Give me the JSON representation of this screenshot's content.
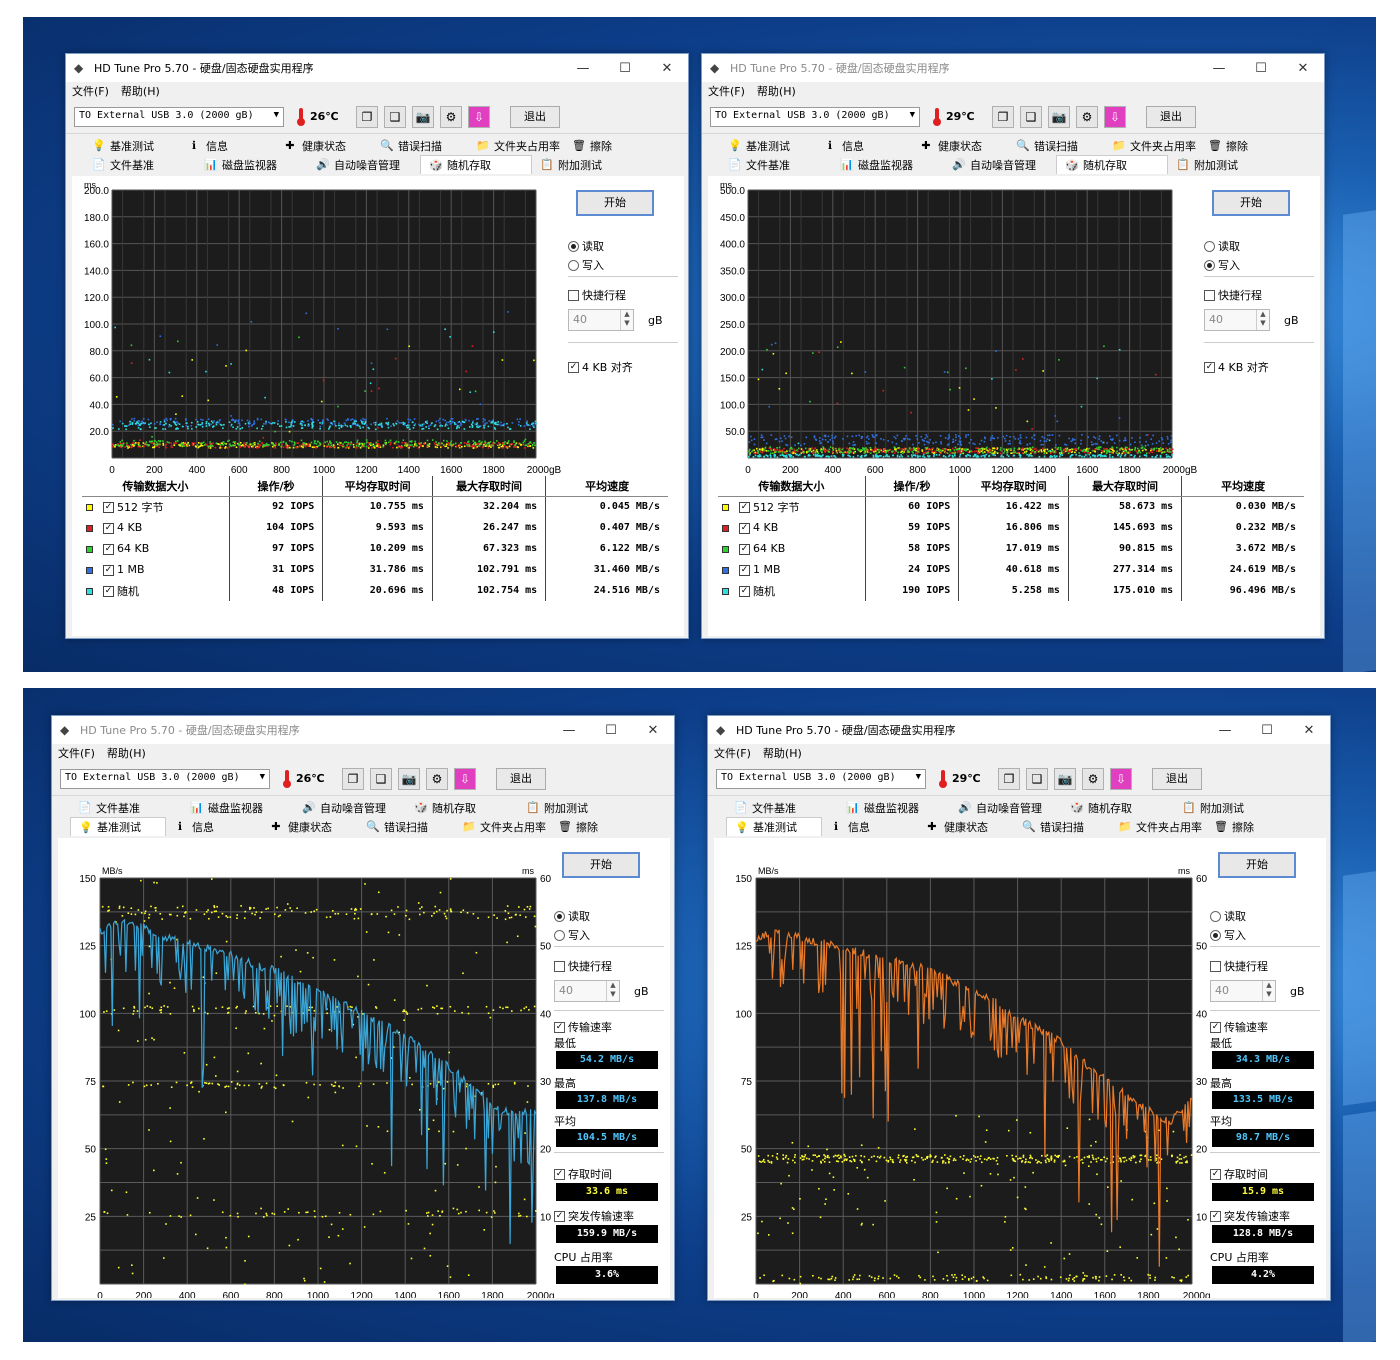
{
  "colors": {
    "blue": "#3aa6d8",
    "orange": "#e87a2a",
    "yellow": "#ffff30",
    "grid": "#5a5a5a"
  },
  "windows": [
    {
      "id": "w1",
      "title": "HD Tune Pro 5.70 - 硬盘/固态硬盘实用程序",
      "menus": [
        "文件(F)",
        "帮助(H)"
      ],
      "drive": "TO External USB 3.0 (2000 gB)",
      "temp": "26℃",
      "exit": "退出",
      "tabs_top": [
        "基准测试",
        "信息",
        "健康状态",
        "错误扫描",
        "文件夹占用率",
        "擦除"
      ],
      "tabs_bottom": [
        "文件基准",
        "磁盘监视器",
        "自动噪音管理",
        "随机存取",
        "附加测试"
      ],
      "start": "开始",
      "read": "读取",
      "write": "写入",
      "quick": "快捷行程",
      "quick_val": "40",
      "gb": "gB",
      "align": "4 KB 对齐",
      "y_unit": "ms",
      "y_ticks": [
        "200.0",
        "180.0",
        "160.0",
        "140.0",
        "120.0",
        "100.0",
        "80.0",
        "60.0",
        "40.0",
        "20.0"
      ],
      "x_ticks": [
        "0",
        "200",
        "400",
        "600",
        "800",
        "1000",
        "1200",
        "1400",
        "1600",
        "1800",
        "2000gB"
      ],
      "headers": [
        "传输数据大小",
        "操作/秒",
        "平均存取时间",
        "最大存取时间",
        "平均速度"
      ],
      "rows": [
        {
          "size": "512 字节",
          "iops": "92 IOPS",
          "avg": "10.755 ms",
          "max": "32.204 ms",
          "speed": "0.045 MB/s",
          "color": "#ffff00"
        },
        {
          "size": "4 KB",
          "iops": "104 IOPS",
          "avg": "9.593 ms",
          "max": "26.247 ms",
          "speed": "0.407 MB/s",
          "color": "#e02020"
        },
        {
          "size": "64 KB",
          "iops": "97 IOPS",
          "avg": "10.209 ms",
          "max": "67.323 ms",
          "speed": "6.122 MB/s",
          "color": "#30d030"
        },
        {
          "size": "1 MB",
          "iops": "31 IOPS",
          "avg": "31.786 ms",
          "max": "102.791 ms",
          "speed": "31.460 MB/s",
          "color": "#3070e0"
        },
        {
          "size": "随机",
          "iops": "48 IOPS",
          "avg": "20.696 ms",
          "max": "102.754 ms",
          "speed": "24.516 MB/s",
          "color": "#30e0e0"
        }
      ]
    },
    {
      "id": "w2",
      "title": "HD Tune Pro 5.70 - 硬盘/固态硬盘实用程序",
      "menus": [
        "文件(F)",
        "帮助(H)"
      ],
      "drive": "TO External USB 3.0 (2000 gB)",
      "temp": "29℃",
      "exit": "退出",
      "tabs_top": [
        "基准测试",
        "信息",
        "健康状态",
        "错误扫描",
        "文件夹占用率",
        "擦除"
      ],
      "tabs_bottom": [
        "文件基准",
        "磁盘监视器",
        "自动噪音管理",
        "随机存取",
        "附加测试"
      ],
      "start": "开始",
      "read": "读取",
      "write": "写入",
      "quick": "快捷行程",
      "quick_val": "40",
      "gb": "gB",
      "align": "4 KB 对齐",
      "y_unit": "ms",
      "y_ticks": [
        "500.0",
        "450.0",
        "400.0",
        "350.0",
        "300.0",
        "250.0",
        "200.0",
        "150.0",
        "100.0",
        "50.0"
      ],
      "x_ticks": [
        "0",
        "200",
        "400",
        "600",
        "800",
        "1000",
        "1200",
        "1400",
        "1600",
        "1800",
        "2000gB"
      ],
      "headers": [
        "传输数据大小",
        "操作/秒",
        "平均存取时间",
        "最大存取时间",
        "平均速度"
      ],
      "rows": [
        {
          "size": "512 字节",
          "iops": "60 IOPS",
          "avg": "16.422 ms",
          "max": "58.673 ms",
          "speed": "0.030 MB/s",
          "color": "#ffff00"
        },
        {
          "size": "4 KB",
          "iops": "59 IOPS",
          "avg": "16.806 ms",
          "max": "145.693 ms",
          "speed": "0.232 MB/s",
          "color": "#e02020"
        },
        {
          "size": "64 KB",
          "iops": "58 IOPS",
          "avg": "17.019 ms",
          "max": "90.815 ms",
          "speed": "3.672 MB/s",
          "color": "#30d030"
        },
        {
          "size": "1 MB",
          "iops": "24 IOPS",
          "avg": "40.618 ms",
          "max": "277.314 ms",
          "speed": "24.619 MB/s",
          "color": "#3070e0"
        },
        {
          "size": "随机",
          "iops": "190 IOPS",
          "avg": "5.258 ms",
          "max": "175.010 ms",
          "speed": "96.496 MB/s",
          "color": "#30e0e0"
        }
      ]
    },
    {
      "id": "w3",
      "title": "HD Tune Pro 5.70 - 硬盘/固态硬盘实用程序",
      "menus": [
        "文件(F)",
        "帮助(H)"
      ],
      "drive": "TO External USB 3.0 (2000 gB)",
      "temp": "26℃",
      "exit": "退出",
      "tabs_top": [
        "文件基准",
        "磁盘监视器",
        "自动噪音管理",
        "随机存取",
        "附加测试"
      ],
      "tabs_bottom": [
        "基准测试",
        "信息",
        "健康状态",
        "错误扫描",
        "文件夹占用率",
        "擦除"
      ],
      "start": "开始",
      "read": "读取",
      "write": "写入",
      "quick": "快捷行程",
      "quick_val": "40",
      "gb": "gB",
      "transfer": "传输速率",
      "min_label": "最低",
      "min": "54.2 MB/s",
      "max_label": "最高",
      "max": "137.8 MB/s",
      "avg_label": "平均",
      "avg": "104.5 MB/s",
      "access_label": "存取时间",
      "access": "33.6 ms",
      "burst_label": "突发传输速率",
      "burst": "159.9 MB/s",
      "cpu_label": "CPU 占用率",
      "cpu": "3.6%",
      "y_left_unit": "MB/s",
      "y_right_unit": "ms",
      "y_left_ticks": [
        "150",
        "125",
        "100",
        "75",
        "50",
        "25"
      ],
      "y_right_ticks": [
        "60",
        "50",
        "40",
        "30",
        "20",
        "10"
      ],
      "x_ticks": [
        "0",
        "200",
        "400",
        "600",
        "800",
        "1000",
        "1200",
        "1400",
        "1600",
        "1800",
        "2000gB"
      ]
    },
    {
      "id": "w4",
      "title": "HD Tune Pro 5.70 - 硬盘/固态硬盘实用程序",
      "menus": [
        "文件(F)",
        "帮助(H)"
      ],
      "drive": "TO External USB 3.0 (2000 gB)",
      "temp": "29℃",
      "exit": "退出",
      "tabs_top": [
        "文件基准",
        "磁盘监视器",
        "自动噪音管理",
        "随机存取",
        "附加测试"
      ],
      "tabs_bottom": [
        "基准测试",
        "信息",
        "健康状态",
        "错误扫描",
        "文件夹占用率",
        "擦除"
      ],
      "start": "开始",
      "read": "读取",
      "write": "写入",
      "quick": "快捷行程",
      "quick_val": "40",
      "gb": "gB",
      "transfer": "传输速率",
      "min_label": "最低",
      "min": "34.3 MB/s",
      "max_label": "最高",
      "max": "133.5 MB/s",
      "avg_label": "平均",
      "avg": "98.7 MB/s",
      "access_label": "存取时间",
      "access": "15.9 ms",
      "burst_label": "突发传输速率",
      "burst": "128.8 MB/s",
      "cpu_label": "CPU 占用率",
      "cpu": "4.2%",
      "y_left_unit": "MB/s",
      "y_right_unit": "ms",
      "y_left_ticks": [
        "150",
        "125",
        "100",
        "75",
        "50",
        "25"
      ],
      "y_right_ticks": [
        "60",
        "50",
        "40",
        "30",
        "20",
        "10"
      ],
      "x_ticks": [
        "0",
        "200",
        "400",
        "600",
        "800",
        "1000",
        "1200",
        "1400",
        "1600",
        "1800",
        "2000gB"
      ]
    }
  ],
  "chart_data": [
    {
      "type": "scatter",
      "title": "",
      "ylabel": "ms",
      "xlim": [
        0,
        2000
      ],
      "ylim": [
        0,
        200
      ],
      "series": [
        {
          "name": "512 字节",
          "band": [
            8,
            12
          ]
        },
        {
          "name": "4 KB",
          "band": [
            8,
            12
          ]
        },
        {
          "name": "64 KB",
          "band": [
            9,
            14
          ]
        },
        {
          "name": "1 MB",
          "band": [
            24,
            30
          ]
        },
        {
          "name": "随机",
          "band": [
            22,
            28
          ]
        }
      ]
    },
    {
      "type": "scatter",
      "title": "",
      "ylabel": "ms",
      "xlim": [
        0,
        2000
      ],
      "ylim": [
        0,
        500
      ],
      "series": [
        {
          "name": "512 字节",
          "band": [
            10,
            20
          ]
        },
        {
          "name": "4 KB",
          "band": [
            10,
            20
          ]
        },
        {
          "name": "64 KB",
          "band": [
            10,
            22
          ]
        },
        {
          "name": "1 MB",
          "band": [
            25,
            45
          ]
        },
        {
          "name": "随机",
          "band": [
            3,
            8
          ]
        }
      ]
    },
    {
      "type": "line",
      "title": "",
      "ylabel": "MB/s",
      "xlim": [
        0,
        2000
      ],
      "ylim": [
        0,
        150
      ],
      "x": [
        0,
        100,
        200,
        300,
        400,
        500,
        600,
        700,
        800,
        900,
        1000,
        1100,
        1200,
        1300,
        1400,
        1500,
        1600,
        1700,
        1800,
        1900,
        2000
      ],
      "series": [
        {
          "values": [
            130,
            134,
            132,
            128,
            126,
            124,
            122,
            118,
            116,
            112,
            108,
            104,
            100,
            96,
            92,
            86,
            80,
            74,
            66,
            62,
            64
          ]
        }
      ]
    },
    {
      "type": "line",
      "title": "",
      "ylabel": "MB/s",
      "xlim": [
        0,
        2000
      ],
      "ylim": [
        0,
        150
      ],
      "x": [
        0,
        100,
        200,
        300,
        400,
        500,
        600,
        700,
        800,
        900,
        1000,
        1100,
        1200,
        1300,
        1400,
        1500,
        1600,
        1700,
        1800,
        1900,
        2000
      ],
      "series": [
        {
          "values": [
            128,
            130,
            128,
            126,
            124,
            122,
            120,
            118,
            116,
            112,
            108,
            104,
            98,
            94,
            90,
            82,
            76,
            70,
            64,
            60,
            68
          ]
        }
      ]
    }
  ]
}
